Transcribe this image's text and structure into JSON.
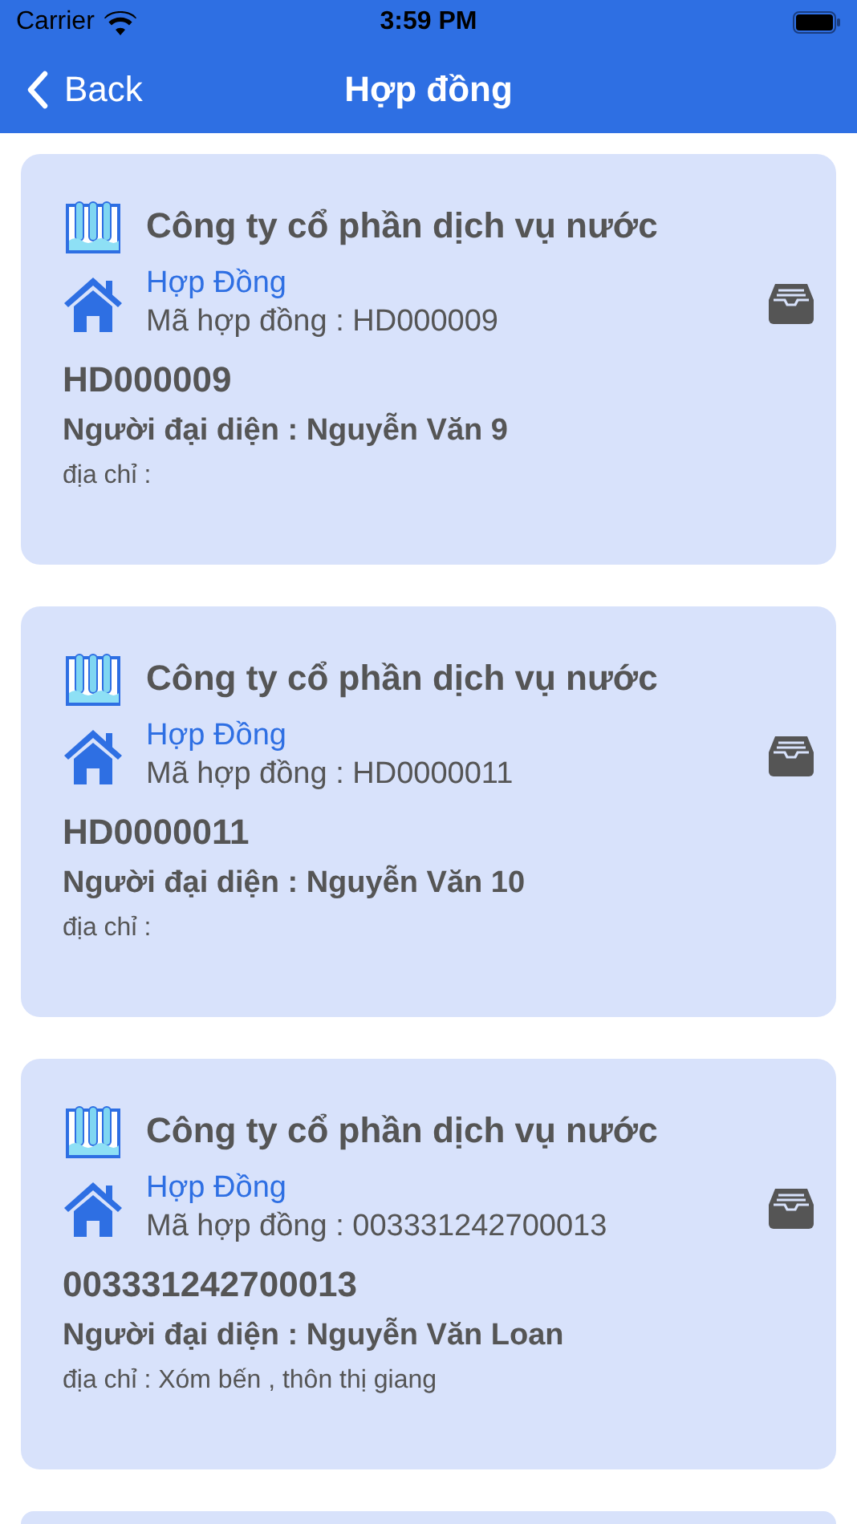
{
  "status_bar": {
    "carrier": "Carrier",
    "time": "3:59 PM"
  },
  "nav_bar": {
    "back": "Back",
    "title": "Hợp đồng"
  },
  "contracts": [
    {
      "company": "Công ty cổ phần dịch vụ nước",
      "type": "Hợp Đồng",
      "contract_no": "Mã hợp đồng : HD000009",
      "code": "HD000009",
      "representative": "Người đại diện : Nguyễn Văn 9",
      "address": "địa chỉ :"
    },
    {
      "company": "Công ty cổ phần dịch vụ nước",
      "type": "Hợp Đồng",
      "contract_no": "Mã hợp đồng : HD0000011",
      "code": "HD0000011",
      "representative": "Người đại diện : Nguyễn Văn 10",
      "address": "địa chỉ :"
    },
    {
      "company": "Công ty cổ phần dịch vụ nước",
      "type": "Hợp Đồng",
      "contract_no": "Mã hợp đồng : 003331242700013",
      "code": "003331242700013",
      "representative": "Người đại diện : Nguyễn Văn Loan",
      "address": "địa chỉ : Xóm bến , thôn thị giang"
    }
  ]
}
